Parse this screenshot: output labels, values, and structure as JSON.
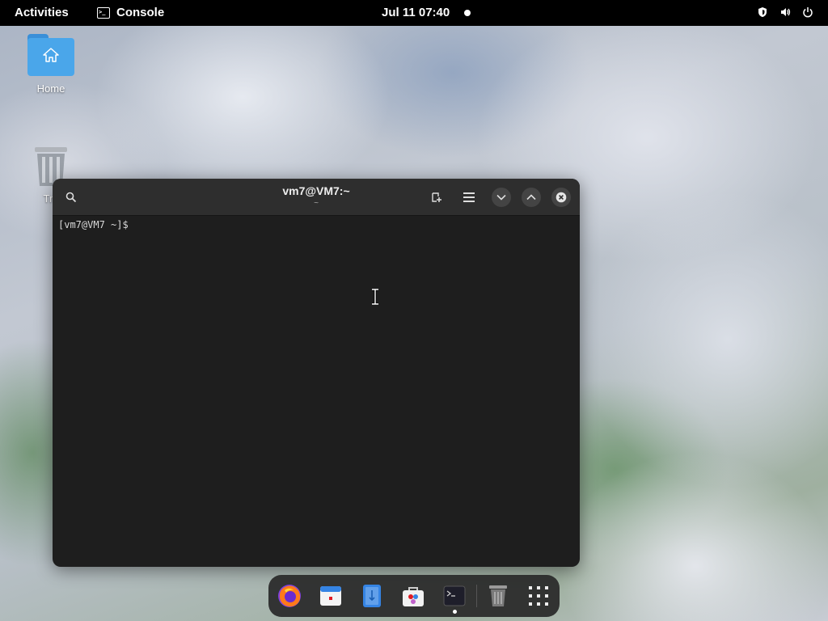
{
  "topbar": {
    "activities_label": "Activities",
    "app_name": "Console",
    "clock": "Jul 11  07:40",
    "tray_icons": [
      "shield-icon",
      "volume-icon",
      "power-icon"
    ]
  },
  "desktop": {
    "icons": [
      {
        "label": "Home",
        "icon": "home-folder-icon"
      },
      {
        "label": "Tra",
        "icon": "trash-icon"
      }
    ]
  },
  "window": {
    "title": "vm7@VM7:~",
    "subtitle": "~",
    "prompt": "[vm7@VM7 ~]$",
    "buttons": [
      "search-icon",
      "new-tab-icon",
      "menu-icon",
      "minimize-icon",
      "maximize-icon",
      "close-icon"
    ]
  },
  "dock": {
    "apps": [
      "firefox-icon",
      "calendar-icon",
      "text-editor-icon",
      "software-icon",
      "console-icon",
      "trash-icon",
      "app-grid-icon"
    ],
    "running": "console-icon"
  },
  "colors": {
    "topbar_bg": "#000000",
    "terminal_bg": "#1e1e1e",
    "headerbar_bg": "#2e2e2e",
    "folder_blue": "#4aa6ea"
  }
}
